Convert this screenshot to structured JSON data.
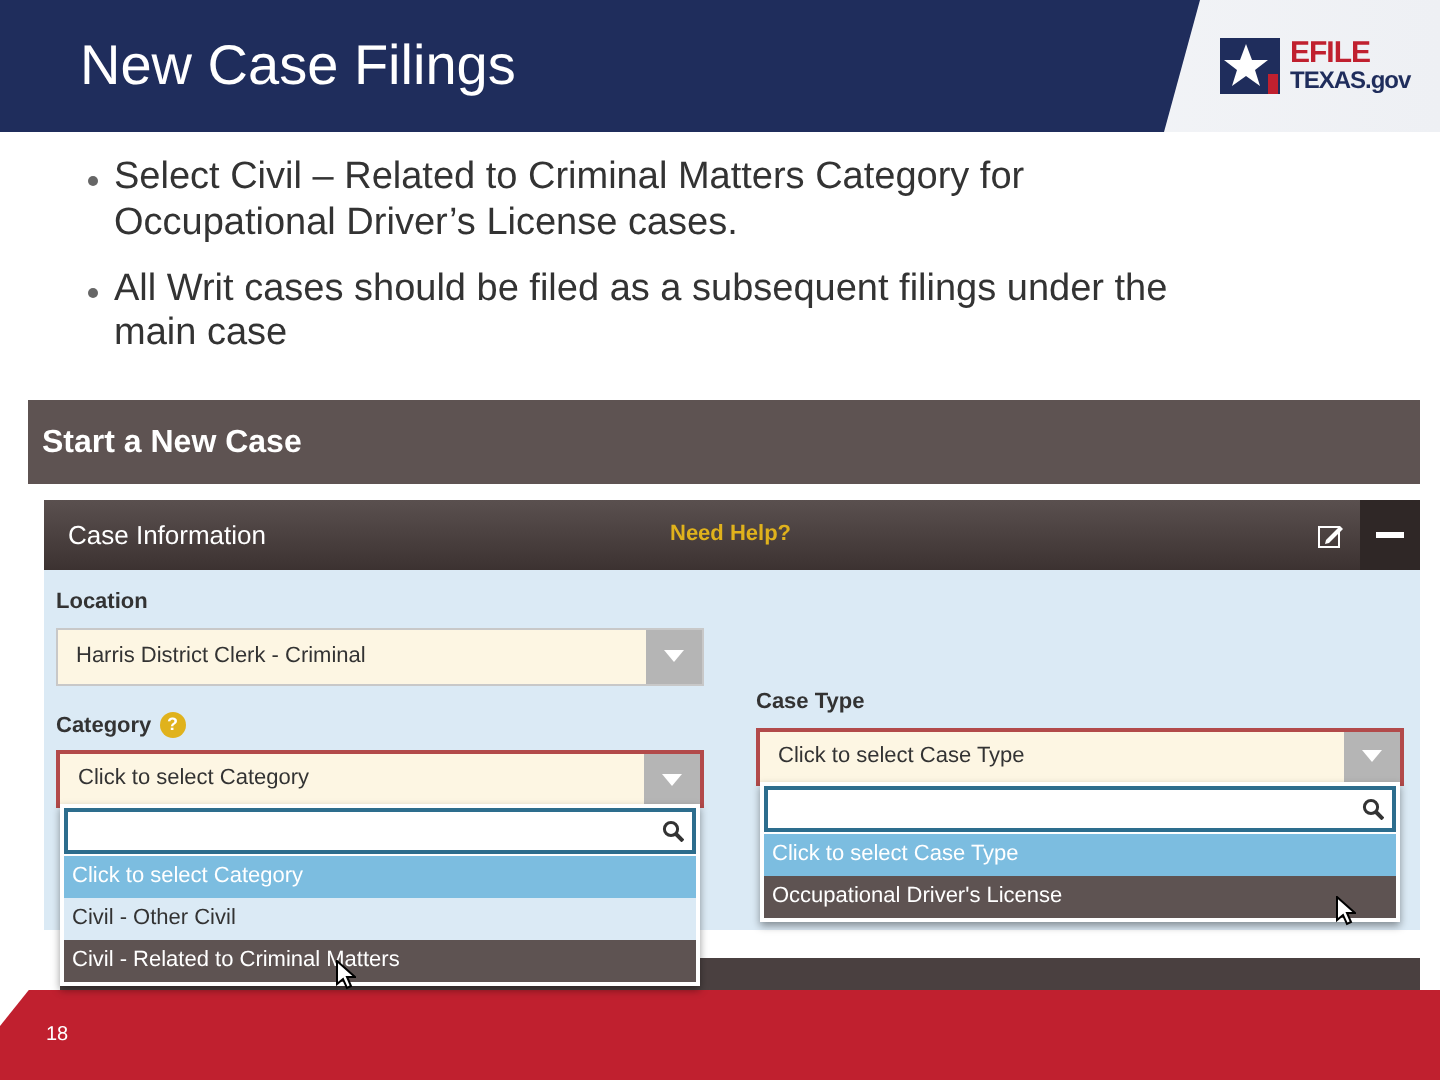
{
  "slide": {
    "title": "New Case Filings",
    "logo_lines": [
      "EFILE",
      "TEXAS.gov"
    ],
    "bullets": [
      "Select Civil – Related to Criminal Matters Category for Occupational Driver’s License cases.",
      "All Writ cases should be filed as a subsequent filings under the main case"
    ],
    "page_number": "18"
  },
  "app": {
    "header": "Start a New Case",
    "panel_title": "Case Information",
    "help_link": "Need Help?",
    "left_fields": [
      {
        "label": "Location",
        "value": "Harris District Clerk - Criminal",
        "open": false
      },
      {
        "label": "Category",
        "value": "Click to select Category",
        "open": true,
        "help_mark": "?",
        "options": [
          {
            "label": "Click to select Category",
            "selected": true,
            "hovered": false
          },
          {
            "label": "Civil - Other Civil",
            "selected": false,
            "hovered": false
          },
          {
            "label": "Civil - Related to Criminal Matters",
            "selected": false,
            "hovered": true
          }
        ]
      }
    ],
    "right_fields": [
      {
        "label": "Case Type",
        "value": "Click to select Case Type",
        "open": true,
        "options": [
          {
            "label": "Click to select Case Type",
            "selected": true,
            "hovered": false
          },
          {
            "label": "Occupational Driver's License",
            "selected": false,
            "hovered": true
          }
        ]
      }
    ]
  }
}
